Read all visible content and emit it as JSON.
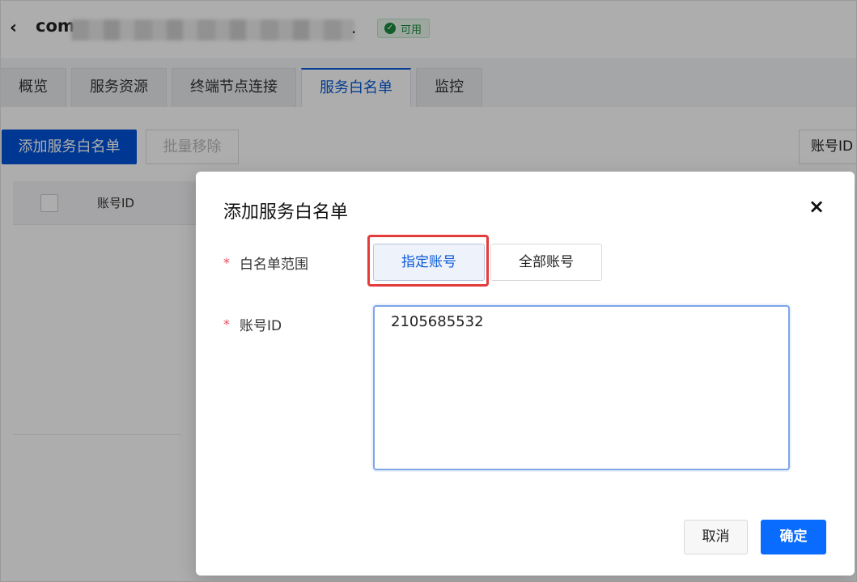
{
  "header": {
    "title_prefix": "com",
    "title_suffix": ".",
    "status": "可用"
  },
  "tabs": [
    {
      "label": "概览"
    },
    {
      "label": "服务资源"
    },
    {
      "label": "终端节点连接"
    },
    {
      "label": "服务白名单"
    },
    {
      "label": "监控"
    }
  ],
  "toolbar": {
    "add_label": "添加服务白名单",
    "batch_remove_label": "批量移除",
    "filter_label": "账号ID"
  },
  "table": {
    "columns": [
      "账号ID"
    ]
  },
  "dialog": {
    "title": "添加服务白名单",
    "scope_label": "白名单范围",
    "scope_options": [
      "指定账号",
      "全部账号"
    ],
    "selected_scope": "指定账号",
    "account_label": "账号ID",
    "account_value": "2105685532",
    "required_mark": "*",
    "cancel_label": "取消",
    "confirm_label": "确定",
    "close_icon": "close-icon"
  },
  "colors": {
    "primary": "#0052d9",
    "highlight": "#e43b3b",
    "status_green": "#1b8a3c"
  }
}
